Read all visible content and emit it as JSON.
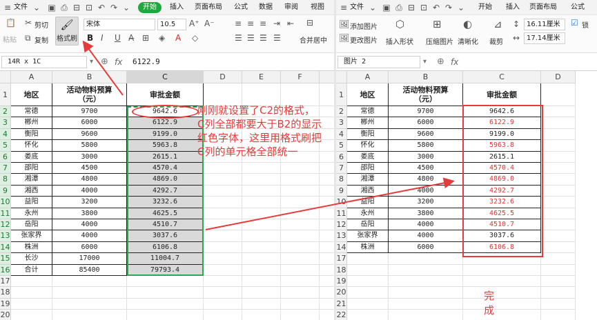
{
  "left": {
    "quick_access": {
      "file_label": "文件"
    },
    "tabs": [
      "开始",
      "插入",
      "页面布局",
      "公式",
      "数据",
      "审阅",
      "视图"
    ],
    "ribbon": {
      "paste": "粘贴",
      "cut": "剪切",
      "copy": "复制",
      "format_painter": "格式刷",
      "font_name": "宋体",
      "font_size": "10.5",
      "merge_center": "合并居中"
    },
    "name_box": "14R x 1C",
    "fx_symbol": "fx",
    "formula_value": "6122.9",
    "columns": [
      "A",
      "B",
      "C",
      "D",
      "E",
      "F",
      "G"
    ],
    "row_numbers": [
      "1",
      "2",
      "3",
      "4",
      "5",
      "6",
      "7",
      "8",
      "9",
      "10",
      "11",
      "12",
      "13",
      "14",
      "15",
      "16",
      "17",
      "18",
      "19",
      "20"
    ],
    "table_header": [
      "地区",
      "活动物料预算\n（元）",
      "审批金额"
    ],
    "rows": [
      [
        "常德",
        "9700",
        "9642.6"
      ],
      [
        "郴州",
        "6000",
        "6122.9"
      ],
      [
        "衡阳",
        "9600",
        "9199.0"
      ],
      [
        "怀化",
        "5800",
        "5963.8"
      ],
      [
        "娄底",
        "3000",
        "2615.1"
      ],
      [
        "邵阳",
        "4500",
        "4570.4"
      ],
      [
        "湘潭",
        "4800",
        "4869.0"
      ],
      [
        "湘西",
        "4000",
        "4292.7"
      ],
      [
        "益阳",
        "3200",
        "3232.6"
      ],
      [
        "永州",
        "3800",
        "4625.5"
      ],
      [
        "岳阳",
        "4000",
        "4510.7"
      ],
      [
        "张家界",
        "4000",
        "3037.6"
      ],
      [
        "株洲",
        "6000",
        "6106.8"
      ],
      [
        "长沙",
        "17000",
        "11004.7"
      ],
      [
        "合计",
        "85400",
        "79793.4"
      ]
    ],
    "annotation": "刚刚就设置了C2的格式，\nC列全部都要大于B2的显示\n红色字体，这里用格式刷把\nC列的单元格全部统一"
  },
  "right": {
    "quick_access": {
      "file_label": "文件"
    },
    "tabs": [
      "开始",
      "插入",
      "页面布局",
      "公式"
    ],
    "ribbon": {
      "add_image": "添加图片",
      "change_image": "更改图片",
      "insert_shape": "插入形状",
      "compress_image": "压缩图片",
      "sharpen": "清晰化",
      "crop": "裁剪",
      "height": "16.11厘米",
      "width": "17.14厘米",
      "lock_ratio": "锁"
    },
    "name_box": "图片 2",
    "columns": [
      "A",
      "B",
      "C",
      "D"
    ],
    "row_numbers": [
      "1",
      "2",
      "3",
      "4",
      "5",
      "6",
      "7",
      "8",
      "9",
      "10",
      "11",
      "12",
      "13",
      "14",
      "17",
      "18",
      "19",
      "20",
      "21",
      "22"
    ],
    "table_header": [
      "地区",
      "活动物料预算\n（元）",
      "审批金额"
    ],
    "rows": [
      [
        "常德",
        "9700",
        "9642.6"
      ],
      [
        "郴州",
        "6000",
        "6122.9"
      ],
      [
        "衡阳",
        "9600",
        "9199.0"
      ],
      [
        "怀化",
        "5800",
        "5963.8"
      ],
      [
        "娄底",
        "3000",
        "2615.1"
      ],
      [
        "邵阳",
        "4500",
        "4570.4"
      ],
      [
        "湘潭",
        "4800",
        "4869.0"
      ],
      [
        "湘西",
        "4000",
        "4292.7"
      ],
      [
        "益阳",
        "3200",
        "3232.6"
      ],
      [
        "永州",
        "3800",
        "4625.5"
      ],
      [
        "岳阳",
        "4000",
        "4510.7"
      ],
      [
        "张家界",
        "4000",
        "3037.6"
      ],
      [
        "株洲",
        "6000",
        "6106.8"
      ]
    ],
    "red_value_flags": [
      false,
      true,
      false,
      true,
      false,
      true,
      true,
      true,
      true,
      true,
      true,
      false,
      true
    ],
    "done_label": "完成"
  },
  "colors": {
    "accent_green": "#1fa83d",
    "annotation_red": "#e53b3b",
    "value_red": "#e33333"
  }
}
